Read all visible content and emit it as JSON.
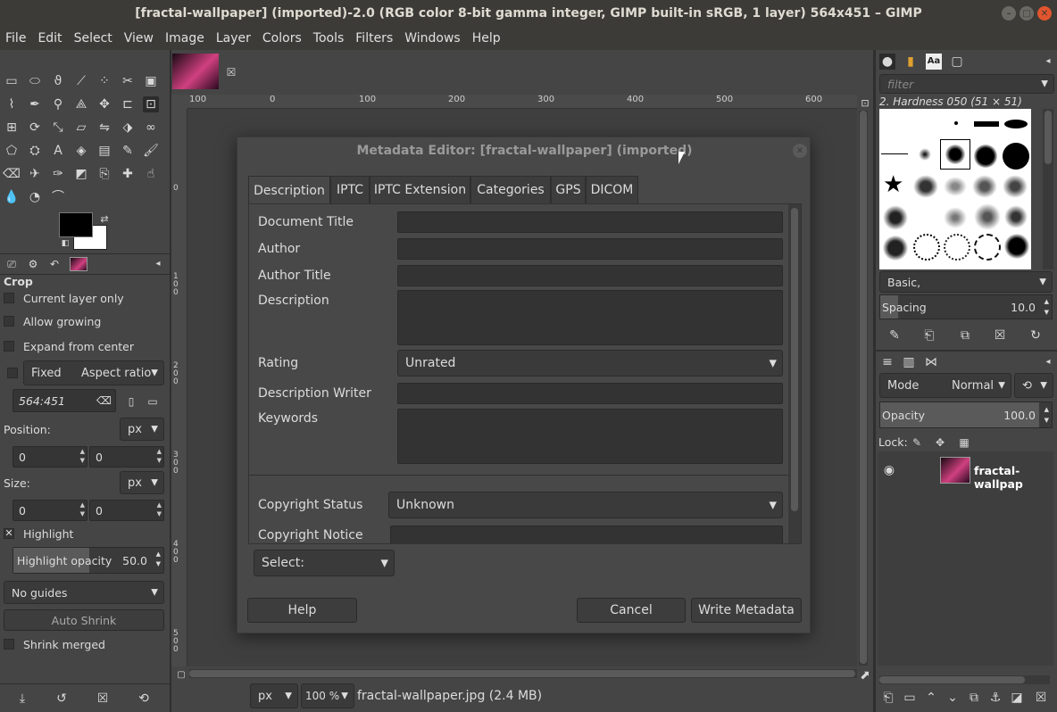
{
  "window": {
    "title": "[fractal-wallpaper] (imported)-2.0 (RGB color 8-bit gamma integer, GIMP built-in sRGB, 1 layer) 564x451 – GIMP"
  },
  "menu": [
    "File",
    "Edit",
    "Select",
    "View",
    "Image",
    "Layer",
    "Colors",
    "Tools",
    "Filters",
    "Windows",
    "Help"
  ],
  "tool_options": {
    "tool_name": "Crop",
    "current_layer_only": "Current layer only",
    "allow_growing": "Allow growing",
    "expand_from_center": "Expand from center",
    "fixed_label": "Fixed",
    "fixed_mode": "Aspect ratio",
    "ratio_value": "564:451",
    "position_label": "Position:",
    "position_unit": "px",
    "position_x": "0",
    "position_y": "0",
    "size_label": "Size:",
    "size_unit": "px",
    "size_w": "0",
    "size_h": "0",
    "highlight": "Highlight",
    "highlight_opacity_label": "Highlight opacity",
    "highlight_opacity_value": "50.0",
    "guides": "No guides",
    "auto_shrink": "Auto Shrink",
    "shrink_merged": "Shrink merged"
  },
  "rulers": {
    "h_ticks": [
      "100",
      "0",
      "100",
      "200",
      "300",
      "400",
      "500",
      "600"
    ],
    "v_ticks": [
      "0",
      "1 0 0",
      "2 0 0",
      "3 0 0",
      "4 0 0",
      "5 0 0"
    ]
  },
  "dialog": {
    "title": "Metadata Editor: [fractal-wallpaper] (imported)",
    "tabs": [
      "Description",
      "IPTC",
      "IPTC Extension",
      "Categories",
      "GPS",
      "DICOM"
    ],
    "fields": {
      "document_title": "Document Title",
      "author": "Author",
      "author_title": "Author Title",
      "description": "Description",
      "rating": "Rating",
      "rating_value": "Unrated",
      "description_writer": "Description Writer",
      "keywords": "Keywords",
      "copyright_status": "Copyright Status",
      "copyright_status_value": "Unknown",
      "copyright_notice": "Copyright Notice"
    },
    "select_label": "Select:",
    "help": "Help",
    "cancel": "Cancel",
    "write": "Write Metadata"
  },
  "status": {
    "unit": "px",
    "zoom": "100 %",
    "file": "fractal-wallpaper.jpg (2.4 MB)"
  },
  "brushes": {
    "filter_placeholder": "filter",
    "current": "2. Hardness 050 (51 × 51)",
    "tag": "Basic,",
    "spacing_label": "Spacing",
    "spacing_value": "10.0"
  },
  "layers": {
    "mode_label": "Mode",
    "mode_value": "Normal",
    "opacity_label": "Opacity",
    "opacity_value": "100.0",
    "lock_label": "Lock:",
    "layer_name": "fractal-wallpap"
  },
  "colors": {
    "accent": "#d04080",
    "fg": "#000000",
    "bg": "#ffffff"
  }
}
